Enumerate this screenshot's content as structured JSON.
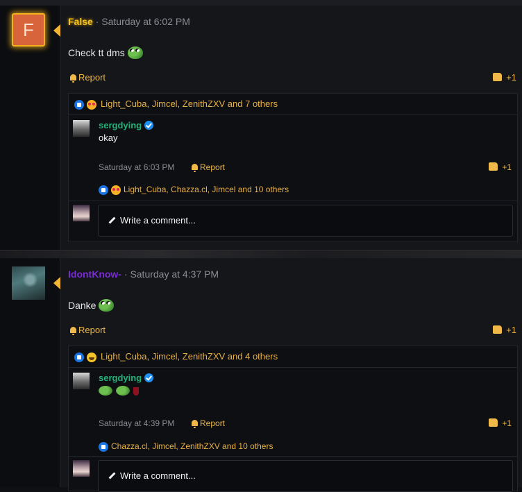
{
  "posts": [
    {
      "username": "False",
      "avatar_letter": "F",
      "timestamp": "Saturday at 6:02 PM",
      "message": "Check tt dms",
      "report_label": "Report",
      "like_count": "+1",
      "reactions_text": "Light_Cuba, Jimcel, ZenithZXV and 7 others",
      "comment": {
        "author": "sergdying",
        "text": "okay",
        "timestamp": "Saturday at 6:03 PM",
        "report_label": "Report",
        "like_count": "+1",
        "reactions_text": "Light_Cuba, Chazza.cl, Jimcel and 10 others"
      },
      "write_comment_label": "Write a comment..."
    },
    {
      "username": "IdontKnow-",
      "timestamp": "Saturday at 4:37 PM",
      "message": "Danke",
      "report_label": "Report",
      "like_count": "+1",
      "reactions_text": "Light_Cuba, Jimcel, ZenithZXV and 4 others",
      "comment": {
        "author": "sergdying",
        "text": "",
        "timestamp": "Saturday at 4:39 PM",
        "report_label": "Report",
        "like_count": "+1",
        "reactions_text": "Chazza.cl, Jimcel, ZenithZXV and 10 others"
      },
      "write_comment_label": "Write a comment..."
    }
  ],
  "colors": {
    "accent_gold": "#f2b533",
    "verified_blue": "#1d8ff2",
    "comment_name_green": "#23b37a",
    "username_purple": "#7a2bd8"
  }
}
